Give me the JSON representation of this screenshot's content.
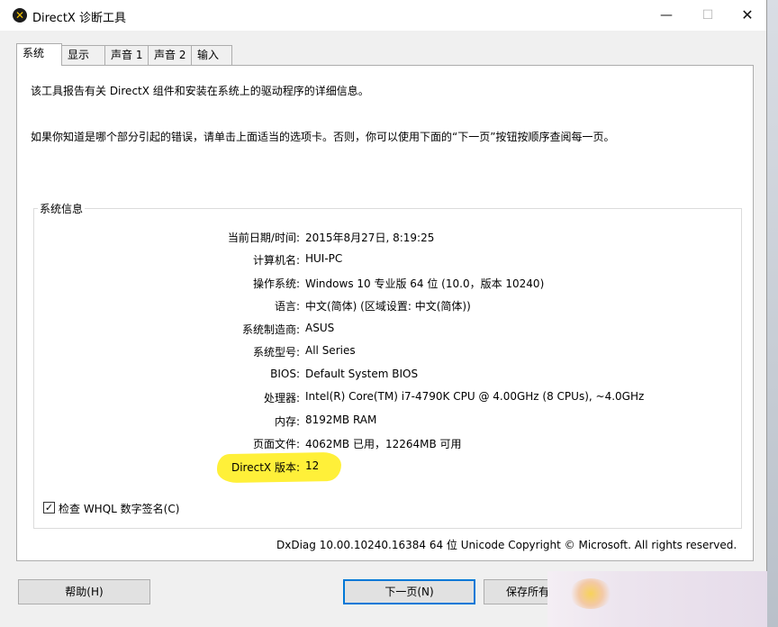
{
  "window": {
    "title": "DirectX 诊断工具",
    "icon": "directx-x-icon",
    "controls": {
      "minimize": "—",
      "maximize": "☐",
      "close": "✕"
    }
  },
  "tabs": [
    {
      "label": "系统",
      "active": true
    },
    {
      "label": "显示",
      "active": false
    },
    {
      "label": "声音 1",
      "active": false
    },
    {
      "label": "声音 2",
      "active": false
    },
    {
      "label": "输入",
      "active": false
    }
  ],
  "intro": {
    "line1": "该工具报告有关 DirectX 组件和安装在系统上的驱动程序的详细信息。",
    "line2": "如果你知道是哪个部分引起的错误，请单击上面适当的选项卡。否则，你可以使用下面的“下一页”按钮按顺序查阅每一页。"
  },
  "system_info": {
    "group_title": "系统信息",
    "rows": [
      {
        "label": "当前日期/时间:",
        "value": "2015年8月27日, 8:19:25"
      },
      {
        "label": "计算机名:",
        "value": "HUI-PC"
      },
      {
        "label": "操作系统:",
        "value": "Windows 10 专业版 64 位 (10.0，版本 10240)"
      },
      {
        "label": "语言:",
        "value": "中文(简体) (区域设置: 中文(简体))"
      },
      {
        "label": "系统制造商:",
        "value": "ASUS"
      },
      {
        "label": "系统型号:",
        "value": "All Series"
      },
      {
        "label": "BIOS:",
        "value": "Default System BIOS"
      },
      {
        "label": "处理器:",
        "value": "Intel(R) Core(TM) i7-4790K CPU @ 4.00GHz (8 CPUs), ~4.0GHz"
      },
      {
        "label": "内存:",
        "value": "8192MB RAM"
      },
      {
        "label": "页面文件:",
        "value": "4062MB 已用，12264MB 可用"
      },
      {
        "label": "DirectX 版本:",
        "value": "12"
      }
    ]
  },
  "whql_checkbox": {
    "label": "检查 WHQL 数字签名(C)",
    "checked": true
  },
  "footer_info": "DxDiag 10.00.10240.16384 64 位 Unicode  Copyright © Microsoft. All rights reserved.",
  "buttons": {
    "help": "帮助(H)",
    "next": "下一页(N)",
    "save": "保存所有"
  },
  "colors": {
    "highlight": "#ffef2e",
    "focus_border": "#0078d7"
  }
}
